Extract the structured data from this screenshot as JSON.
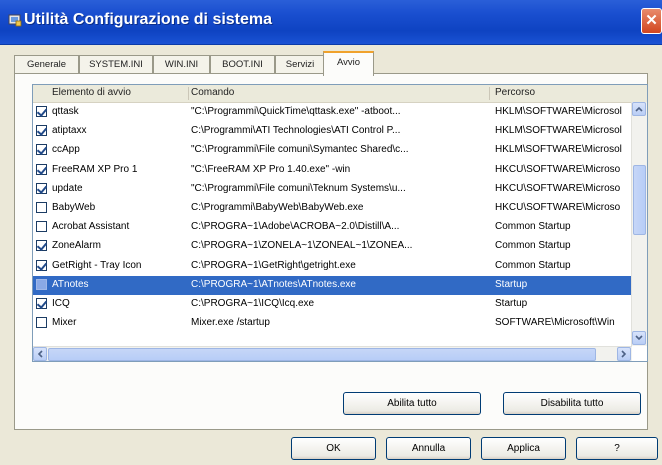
{
  "window": {
    "title": "Utilità Configurazione di sistema",
    "close_glyph": "✕"
  },
  "tabs": [
    {
      "label": "Generale"
    },
    {
      "label": "SYSTEM.INI"
    },
    {
      "label": "WIN.INI"
    },
    {
      "label": "BOOT.INI"
    },
    {
      "label": "Servizi"
    },
    {
      "label": "Avvio",
      "active": true
    }
  ],
  "columns": {
    "name": "Elemento di avvio",
    "command": "Comando",
    "path": "Percorso"
  },
  "rows": [
    {
      "checked": true,
      "name": "qttask",
      "command": "\"C:\\Programmi\\QuickTime\\qttask.exe\" -atboot...",
      "path": "HKLM\\SOFTWARE\\Microsol"
    },
    {
      "checked": true,
      "name": "atiptaxx",
      "command": "C:\\Programmi\\ATI Technologies\\ATI Control P...",
      "path": "HKLM\\SOFTWARE\\Microsol"
    },
    {
      "checked": true,
      "name": "ccApp",
      "command": "\"C:\\Programmi\\File comuni\\Symantec Shared\\c...",
      "path": "HKLM\\SOFTWARE\\Microsol"
    },
    {
      "checked": true,
      "name": "FreeRAM XP Pro 1",
      "command": "\"C:\\FreeRAM XP Pro 1.40.exe\" -win",
      "path": "HKCU\\SOFTWARE\\Microso"
    },
    {
      "checked": true,
      "name": "update",
      "command": "\"C:\\Programmi\\File comuni\\Teknum Systems\\u...",
      "path": "HKCU\\SOFTWARE\\Microso"
    },
    {
      "checked": false,
      "name": "BabyWeb",
      "command": "C:\\Programmi\\BabyWeb\\BabyWeb.exe",
      "path": "HKCU\\SOFTWARE\\Microso"
    },
    {
      "checked": false,
      "name": "Acrobat Assistant",
      "command": "C:\\PROGRA~1\\Adobe\\ACROBA~2.0\\Distill\\A...",
      "path": "Common Startup"
    },
    {
      "checked": true,
      "name": "ZoneAlarm",
      "command": "C:\\PROGRA~1\\ZONELA~1\\ZONEAL~1\\ZONEA...",
      "path": "Common Startup"
    },
    {
      "checked": true,
      "name": "GetRight - Tray Icon",
      "command": "C:\\PROGRA~1\\GetRight\\getright.exe",
      "path": "Common Startup"
    },
    {
      "checked": false,
      "name": "ATnotes",
      "command": "C:\\PROGRA~1\\ATnotes\\ATnotes.exe",
      "path": "Startup",
      "selected": true
    },
    {
      "checked": true,
      "name": "ICQ",
      "command": "C:\\PROGRA~1\\ICQ\\Icq.exe",
      "path": "Startup"
    },
    {
      "checked": false,
      "name": "Mixer",
      "command": "Mixer.exe /startup",
      "path": "SOFTWARE\\Microsoft\\Win"
    }
  ],
  "buttons": {
    "enable_all": "Abilita tutto",
    "disable_all": "Disabilita tutto",
    "ok": "OK",
    "cancel": "Annulla",
    "apply": "Applica",
    "help": "?"
  }
}
